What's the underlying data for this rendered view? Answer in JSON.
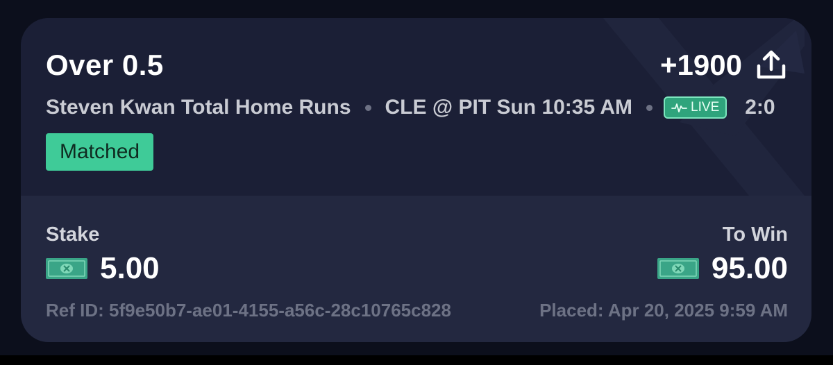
{
  "bet": {
    "selection": "Over 0.5",
    "odds": "+1900",
    "market": "Steven Kwan Total Home Runs",
    "game": "CLE @ PIT Sun 10:35 AM",
    "live_label": "LIVE",
    "score": "2:0",
    "status": "Matched"
  },
  "stake": {
    "label": "Stake",
    "value": "5.00"
  },
  "to_win": {
    "label": "To Win",
    "value": "95.00"
  },
  "ref_id": "Ref ID: 5f9e50b7-ae01-4155-a56c-28c10765c828",
  "placed": "Placed: Apr 20, 2025 9:59 AM",
  "colors": {
    "card": "#232840",
    "card_top": "#1b1f36",
    "accent_green": "#3fcb98",
    "text_primary": "#ffffff",
    "text_muted": "#6d7285"
  },
  "icons": {
    "share": "share-icon",
    "live": "pulse-icon",
    "currency": "cash-icon",
    "watermark": "x-logo-watermark"
  }
}
